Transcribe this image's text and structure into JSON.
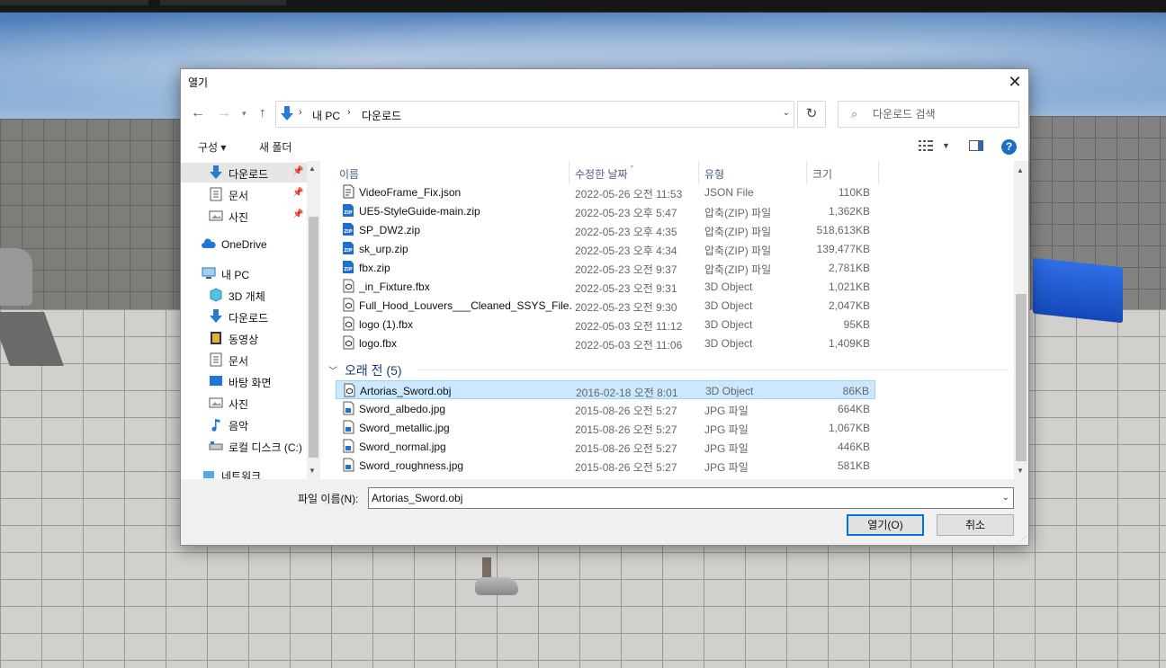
{
  "dialog": {
    "title": "열기",
    "close_glyph": "✕",
    "breadcrumb": [
      "내 PC",
      "다운로드"
    ],
    "search_placeholder": "다운로드 검색",
    "toolbar": {
      "organize": "구성 ▾",
      "new_folder": "새 폴더"
    },
    "sidebar": [
      {
        "label": "다운로드",
        "icon": "download-arrow-icon",
        "pinned": true,
        "selected": true
      },
      {
        "label": "문서",
        "icon": "document-icon",
        "pinned": true
      },
      {
        "label": "사진",
        "icon": "picture-icon",
        "pinned": true
      },
      {
        "label": "OneDrive",
        "icon": "cloud-icon"
      },
      {
        "label": "내 PC",
        "icon": "computer-icon"
      },
      {
        "label": "3D 개체",
        "icon": "3d-objects-icon"
      },
      {
        "label": "다운로드",
        "icon": "download-arrow-icon"
      },
      {
        "label": "동영상",
        "icon": "video-icon"
      },
      {
        "label": "문서",
        "icon": "document-icon"
      },
      {
        "label": "바탕 화면",
        "icon": "desktop-icon"
      },
      {
        "label": "사진",
        "icon": "picture-icon"
      },
      {
        "label": "음악",
        "icon": "music-icon"
      },
      {
        "label": "로컬 디스크 (C:)",
        "icon": "disk-icon"
      },
      {
        "label": "네트워크",
        "icon": "network-icon"
      }
    ],
    "columns": {
      "name": "이름",
      "modified": "수정한 날짜",
      "type": "유형",
      "size": "크기"
    },
    "recent_files": [
      {
        "name": "VideoFrame_Fix.json",
        "date": "2022-05-26 오전 11:53",
        "type": "JSON File",
        "size": "110KB",
        "icon": "json-file-icon"
      },
      {
        "name": "UE5-StyleGuide-main.zip",
        "date": "2022-05-23 오후 5:47",
        "type": "압축(ZIP) 파일",
        "size": "1,362KB",
        "icon": "zip-file-icon"
      },
      {
        "name": "SP_DW2.zip",
        "date": "2022-05-23 오후 4:35",
        "type": "압축(ZIP) 파일",
        "size": "518,613KB",
        "icon": "zip-file-icon"
      },
      {
        "name": "sk_urp.zip",
        "date": "2022-05-23 오후 4:34",
        "type": "압축(ZIP) 파일",
        "size": "139,477KB",
        "icon": "zip-file-icon"
      },
      {
        "name": "fbx.zip",
        "date": "2022-05-23 오전 9:37",
        "type": "압축(ZIP) 파일",
        "size": "2,781KB",
        "icon": "zip-file-icon"
      },
      {
        "name": "_in_Fixture.fbx",
        "date": "2022-05-23 오전 9:31",
        "type": "3D Object",
        "size": "1,021KB",
        "icon": "3d-file-icon"
      },
      {
        "name": "Full_Hood_Louvers___Cleaned_SSYS_File....",
        "date": "2022-05-23 오전 9:30",
        "type": "3D Object",
        "size": "2,047KB",
        "icon": "3d-file-icon"
      },
      {
        "name": "logo (1).fbx",
        "date": "2022-05-03 오전 11:12",
        "type": "3D Object",
        "size": "95KB",
        "icon": "3d-file-icon"
      },
      {
        "name": "logo.fbx",
        "date": "2022-05-03 오전 11:06",
        "type": "3D Object",
        "size": "1,409KB",
        "icon": "3d-file-icon"
      }
    ],
    "group_label": "오래 전 (5)",
    "old_files": [
      {
        "name": "Artorias_Sword.obj",
        "date": "2016-02-18 오전 8:01",
        "type": "3D Object",
        "size": "86KB",
        "icon": "3d-file-icon",
        "selected": true
      },
      {
        "name": "Sword_albedo.jpg",
        "date": "2015-08-26 오전 5:27",
        "type": "JPG 파일",
        "size": "664KB",
        "icon": "image-file-icon"
      },
      {
        "name": "Sword_metallic.jpg",
        "date": "2015-08-26 오전 5:27",
        "type": "JPG 파일",
        "size": "1,067KB",
        "icon": "image-file-icon"
      },
      {
        "name": "Sword_normal.jpg",
        "date": "2015-08-26 오전 5:27",
        "type": "JPG 파일",
        "size": "446KB",
        "icon": "image-file-icon"
      },
      {
        "name": "Sword_roughness.jpg",
        "date": "2015-08-26 오전 5:27",
        "type": "JPG 파일",
        "size": "581KB",
        "icon": "image-file-icon"
      }
    ],
    "filename_label": "파일 이름(N):",
    "filename_value": "Artorias_Sword.obj",
    "open_button": "열기(O)",
    "cancel_button": "취소"
  }
}
